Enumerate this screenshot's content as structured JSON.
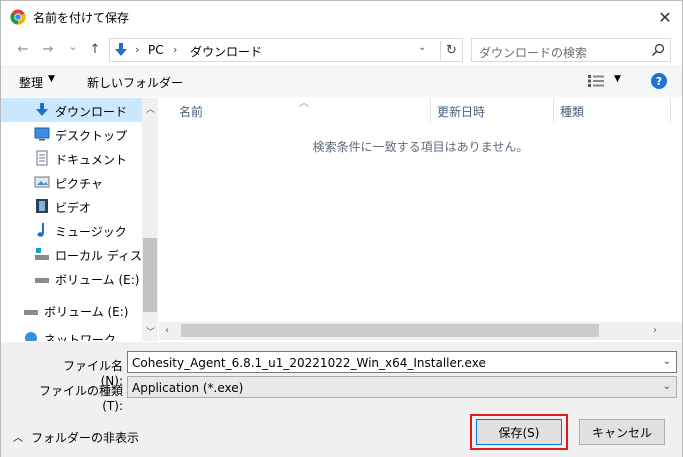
{
  "titlebar": {
    "title": "名前を付けて保存",
    "close": "✕"
  },
  "nav": {
    "back": "←",
    "forward": "→",
    "recent": "⌄",
    "up": "↑",
    "breadcrumb": [
      "PC",
      "ダウンロード"
    ],
    "search_placeholder": "ダウンロードの検索"
  },
  "toolbar": {
    "organize": "整理",
    "new_folder": "新しいフォルダー",
    "help": "?"
  },
  "sidebar": {
    "items": [
      {
        "label": "ダウンロード",
        "icon": "download-icon",
        "selected": true
      },
      {
        "label": "デスクトップ",
        "icon": "desktop-icon"
      },
      {
        "label": "ドキュメント",
        "icon": "documents-icon"
      },
      {
        "label": "ピクチャ",
        "icon": "pictures-icon"
      },
      {
        "label": "ビデオ",
        "icon": "videos-icon"
      },
      {
        "label": "ミュージック",
        "icon": "music-icon"
      },
      {
        "label": "ローカル ディスク (C",
        "icon": "local-disk-icon"
      },
      {
        "label": "ボリューム (E:)",
        "icon": "drive-icon"
      },
      {
        "label": "ボリューム (E:)",
        "icon": "drive-icon"
      },
      {
        "label": "ネットワーク",
        "icon": "network-icon"
      }
    ]
  },
  "columns": {
    "name": "名前",
    "modified": "更新日時",
    "type": "種類"
  },
  "empty_message": "検索条件に一致する項目はありません。",
  "fields": {
    "filename_label": "ファイル名(N):",
    "filename_value": "Cohesity_Agent_6.8.1_u1_20221022_Win_x64_Installer.exe",
    "filetype_label": "ファイルの種類(T):",
    "filetype_value": "Application (*.exe)"
  },
  "footer": {
    "hide_folders": "フォルダーの非表示",
    "save": "保存(S)",
    "cancel": "キャンセル"
  },
  "colors": {
    "accent": "#0078d7",
    "highlight": "#e0191e",
    "selected_bg": "#cce8ff"
  }
}
